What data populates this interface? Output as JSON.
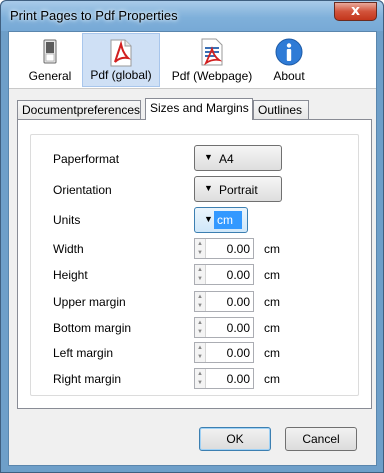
{
  "window": {
    "title": "Print Pages to Pdf Properties",
    "close_glyph": "x"
  },
  "toolbar": {
    "items": [
      {
        "label": "General",
        "icon": "switch-icon"
      },
      {
        "label": "Pdf (global)",
        "icon": "pdf-icon",
        "selected": true
      },
      {
        "label": "Pdf (Webpage)",
        "icon": "pdf-webpage-icon"
      },
      {
        "label": "About",
        "icon": "info-icon"
      }
    ]
  },
  "tabs": [
    {
      "label": "Documentpreferences"
    },
    {
      "label": "Sizes and Margins",
      "active": true
    },
    {
      "label": "Outlines"
    }
  ],
  "form": {
    "paperformat": {
      "label": "Paperformat",
      "value": "A4"
    },
    "orientation": {
      "label": "Orientation",
      "value": "Portrait"
    },
    "units": {
      "label": "Units",
      "value": "cm"
    },
    "width": {
      "label": "Width",
      "value": "0.00",
      "unit": "cm"
    },
    "height": {
      "label": "Height",
      "value": "0.00",
      "unit": "cm"
    },
    "upper_margin": {
      "label": "Upper margin",
      "value": "0.00",
      "unit": "cm"
    },
    "bottom_margin": {
      "label": "Bottom margin",
      "value": "0.00",
      "unit": "cm"
    },
    "left_margin": {
      "label": "Left margin",
      "value": "0.00",
      "unit": "cm"
    },
    "right_margin": {
      "label": "Right margin",
      "value": "0.00",
      "unit": "cm"
    }
  },
  "buttons": {
    "ok": "OK",
    "cancel": "Cancel"
  },
  "colors": {
    "title_bar": "#7fb0da",
    "selected_tool": "#cfe0f5",
    "selection": "#3399ff",
    "close": "#c3361c"
  }
}
